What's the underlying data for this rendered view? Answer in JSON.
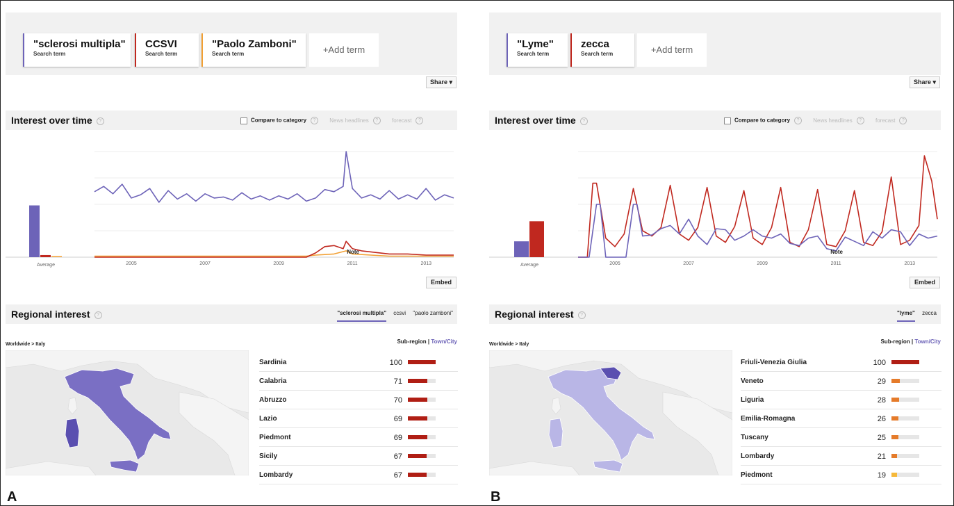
{
  "colors": {
    "purple": "#6d63b8",
    "red": "#c0281f",
    "orange": "#f2a033",
    "bar_strong": "#b01e14",
    "bar_mid": "#e57b2a",
    "bar_low": "#f5b83a"
  },
  "panel_a": {
    "letter": "A",
    "terms": [
      {
        "label": "\"sclerosi multipla\"",
        "sub": "Search term",
        "color": "#6d63b8"
      },
      {
        "label": "CCSVI",
        "sub": "Search term",
        "color": "#c0281f"
      },
      {
        "label": "\"Paolo Zamboni\"",
        "sub": "Search term",
        "color": "#f2a033"
      }
    ],
    "add_term": "+Add term",
    "share": "Share",
    "interest_title": "Interest over time",
    "compare": "Compare to category",
    "news": "News headlines",
    "forecast": "forecast",
    "embed": "Embed",
    "regional_title": "Regional interest",
    "regional_tabs": [
      "\"sclerosi multipla\"",
      "ccsvi",
      "\"paolo zamboni\""
    ],
    "breadcrumb": "Worldwide > Italy",
    "subregion": "Sub-region",
    "towncity": "Town/City",
    "regions": [
      {
        "name": "Sardinia",
        "value": 100
      },
      {
        "name": "Calabria",
        "value": 71
      },
      {
        "name": "Abruzzo",
        "value": 70
      },
      {
        "name": "Lazio",
        "value": 69
      },
      {
        "name": "Piedmont",
        "value": 69
      },
      {
        "name": "Sicily",
        "value": 67
      },
      {
        "name": "Lombardy",
        "value": 67
      }
    ]
  },
  "panel_b": {
    "letter": "B",
    "terms": [
      {
        "label": "\"Lyme\"",
        "sub": "Search term",
        "color": "#6d63b8"
      },
      {
        "label": "zecca",
        "sub": "Search term",
        "color": "#c0281f"
      }
    ],
    "add_term": "+Add term",
    "share": "Share",
    "interest_title": "Interest over time",
    "compare": "Compare to category",
    "news": "News headlines",
    "forecast": "forecast",
    "embed": "Embed",
    "regional_title": "Regional interest",
    "regional_tabs": [
      "\"lyme\"",
      "zecca"
    ],
    "breadcrumb": "Worldwide > Italy",
    "subregion": "Sub-region",
    "towncity": "Town/City",
    "regions": [
      {
        "name": "Friuli-Venezia Giulia",
        "value": 100
      },
      {
        "name": "Veneto",
        "value": 29
      },
      {
        "name": "Liguria",
        "value": 28
      },
      {
        "name": "Emilia-Romagna",
        "value": 26
      },
      {
        "name": "Tuscany",
        "value": 25
      },
      {
        "name": "Lombardy",
        "value": 21
      },
      {
        "name": "Piedmont",
        "value": 19
      }
    ]
  },
  "chart_data": [
    {
      "type": "line",
      "xlabel": "",
      "ylabel": "",
      "x_ticks": [
        "2005",
        "2007",
        "2009",
        "2011",
        "2013"
      ],
      "average_label": "Average",
      "note_label": "Note",
      "ylim": [
        0,
        100
      ],
      "x_range": [
        2004.0,
        2013.75
      ],
      "grid": true,
      "averages": [
        {
          "name": "\"sclerosi multipla\"",
          "value": 49
        },
        {
          "name": "CCSVI",
          "value": 2
        },
        {
          "name": "\"Paolo Zamboni\"",
          "value": 1
        }
      ],
      "series": [
        {
          "name": "\"sclerosi multipla\"",
          "color": "#6d63b8",
          "x": [
            2004.0,
            2004.25,
            2004.5,
            2004.75,
            2005.0,
            2005.25,
            2005.5,
            2005.75,
            2006.0,
            2006.25,
            2006.5,
            2006.75,
            2007.0,
            2007.25,
            2007.5,
            2007.75,
            2008.0,
            2008.25,
            2008.5,
            2008.75,
            2009.0,
            2009.25,
            2009.5,
            2009.75,
            2010.0,
            2010.25,
            2010.5,
            2010.75,
            2010.83,
            2011.0,
            2011.25,
            2011.5,
            2011.75,
            2012.0,
            2012.25,
            2012.5,
            2012.75,
            2013.0,
            2013.25,
            2013.5,
            2013.75
          ],
          "y": [
            62,
            67,
            60,
            69,
            56,
            59,
            65,
            52,
            63,
            55,
            60,
            53,
            60,
            56,
            57,
            54,
            61,
            55,
            58,
            54,
            58,
            55,
            60,
            53,
            56,
            64,
            62,
            67,
            100,
            65,
            56,
            59,
            55,
            63,
            55,
            59,
            55,
            65,
            54,
            59,
            56
          ]
        },
        {
          "name": "CCSVI",
          "color": "#c0281f",
          "x": [
            2004.0,
            2009.0,
            2009.75,
            2010.0,
            2010.25,
            2010.5,
            2010.75,
            2010.83,
            2011.0,
            2011.25,
            2011.5,
            2011.75,
            2012.0,
            2012.5,
            2013.0,
            2013.75
          ],
          "y": [
            0,
            0,
            0,
            4,
            10,
            11,
            8,
            15,
            8,
            6,
            5,
            4,
            3,
            3,
            2,
            2
          ]
        },
        {
          "name": "\"Paolo Zamboni\"",
          "color": "#f2a033",
          "x": [
            2004.0,
            2009.75,
            2010.0,
            2010.5,
            2010.83,
            2011.0,
            2011.5,
            2012.0,
            2013.75
          ],
          "y": [
            1,
            1,
            2,
            3,
            6,
            3,
            2,
            1,
            1
          ]
        }
      ]
    },
    {
      "type": "line",
      "xlabel": "",
      "ylabel": "",
      "x_ticks": [
        "2005",
        "2007",
        "2009",
        "2011",
        "2013"
      ],
      "average_label": "Average",
      "note_label": "Note",
      "ylim": [
        0,
        100
      ],
      "x_range": [
        2004.0,
        2013.75
      ],
      "grid": true,
      "averages": [
        {
          "name": "\"Lyme\"",
          "value": 15
        },
        {
          "name": "zecca",
          "value": 34
        }
      ],
      "series": [
        {
          "name": "\"Lyme\"",
          "color": "#6d63b8",
          "x": [
            2004.0,
            2004.3,
            2004.5,
            2004.6,
            2004.75,
            2005.0,
            2005.3,
            2005.5,
            2005.6,
            2005.75,
            2006.0,
            2006.25,
            2006.5,
            2006.75,
            2007.0,
            2007.25,
            2007.5,
            2007.75,
            2008.0,
            2008.25,
            2008.5,
            2008.75,
            2009.0,
            2009.25,
            2009.5,
            2009.75,
            2010.0,
            2010.25,
            2010.5,
            2010.75,
            2011.0,
            2011.25,
            2011.5,
            2011.75,
            2012.0,
            2012.25,
            2012.5,
            2012.75,
            2013.0,
            2013.25,
            2013.5,
            2013.75
          ],
          "y": [
            0,
            0,
            50,
            50,
            0,
            0,
            0,
            50,
            50,
            20,
            21,
            27,
            30,
            22,
            36,
            20,
            12,
            27,
            26,
            16,
            20,
            26,
            20,
            18,
            22,
            13,
            11,
            18,
            20,
            8,
            6,
            19,
            15,
            11,
            24,
            18,
            26,
            24,
            11,
            22,
            18,
            20
          ]
        },
        {
          "name": "zecca",
          "color": "#c0281f",
          "x": [
            2004.0,
            2004.25,
            2004.4,
            2004.5,
            2004.75,
            2005.0,
            2005.25,
            2005.5,
            2005.75,
            2006.0,
            2006.25,
            2006.5,
            2006.75,
            2007.0,
            2007.25,
            2007.5,
            2007.75,
            2008.0,
            2008.25,
            2008.5,
            2008.75,
            2009.0,
            2009.25,
            2009.5,
            2009.75,
            2010.0,
            2010.25,
            2010.5,
            2010.75,
            2011.0,
            2011.25,
            2011.5,
            2011.75,
            2012.0,
            2012.25,
            2012.5,
            2012.75,
            2013.0,
            2013.25,
            2013.4,
            2013.6,
            2013.75
          ],
          "y": [
            0,
            0,
            70,
            70,
            18,
            10,
            22,
            65,
            25,
            20,
            28,
            68,
            22,
            16,
            28,
            66,
            20,
            14,
            29,
            63,
            18,
            12,
            28,
            66,
            14,
            10,
            26,
            64,
            12,
            10,
            25,
            63,
            14,
            11,
            24,
            76,
            12,
            16,
            30,
            96,
            72,
            36
          ]
        }
      ]
    }
  ]
}
